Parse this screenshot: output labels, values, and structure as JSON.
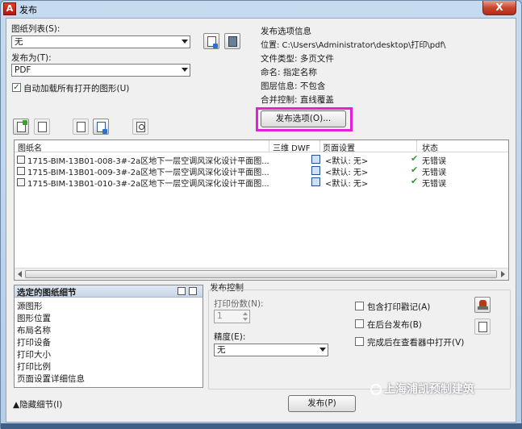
{
  "window": {
    "title": "发布",
    "close_label": "X"
  },
  "left": {
    "sheet_list_label": "图纸列表(S):",
    "sheet_list_value": "无",
    "publish_to_label": "发布为(T):",
    "publish_to_value": "PDF",
    "auto_load_label": "自动加载所有打开的图形(U)",
    "auto_load_checked": true
  },
  "options_info": {
    "heading": "发布选项信息",
    "location": "位置: C:\\Users\\Administrator\\desktop\\打印\\pdf\\",
    "file_type": "文件类型: 多页文件",
    "naming": "命名: 指定名称",
    "layer_info": "图层信息: 不包含",
    "merge_control": "合并控制: 直线覆盖",
    "options_button": "发布选项(O)..."
  },
  "sheet_table": {
    "columns": [
      "图纸名",
      "三维 DWF",
      "页面设置",
      "状态"
    ],
    "rows": [
      {
        "name": "1715-BIM-13B01-008-3#-2a区地下一层空调风深化设计平面图...",
        "page_setup": "<默认: 无>",
        "status": "无错误"
      },
      {
        "name": "1715-BIM-13B01-009-3#-2a区地下一层空调风深化设计平面图...",
        "page_setup": "<默认: 无>",
        "status": "无错误"
      },
      {
        "name": "1715-BIM-13B01-010-3#-2a区地下一层空调风深化设计平面图...",
        "page_setup": "<默认: 无>",
        "status": "无错误"
      }
    ]
  },
  "details": {
    "title": "选定的图纸细节",
    "items": [
      "源图形",
      "图形位置",
      "布局名称",
      "打印设备",
      "打印大小",
      "打印比例",
      "页面设置详细信息"
    ]
  },
  "publish_control": {
    "heading": "发布控制",
    "copies_label": "打印份数(N):",
    "copies_value": "1",
    "precision_label": "精度(E):",
    "precision_value": "无",
    "include_stamp": "包含打印戳记(A)",
    "background": "在后台发布(B)",
    "open_viewer": "完成后在查看器中打开(V)"
  },
  "footer": {
    "hide_details": "▲隐藏细节(I)",
    "publish_button": "发布(P)",
    "watermark": "上海浦凯预制建筑"
  }
}
